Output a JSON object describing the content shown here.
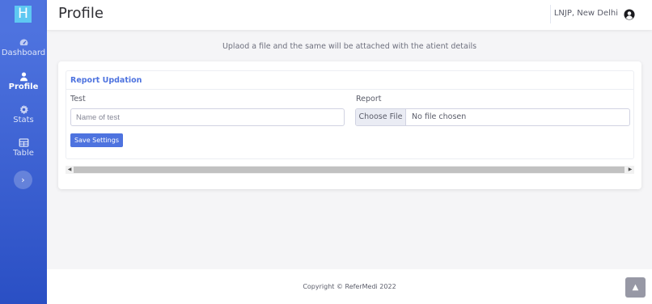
{
  "brand": {
    "letter": "H"
  },
  "sidebar": {
    "items": [
      {
        "label": "Dashboard",
        "icon": "tachometer-icon"
      },
      {
        "label": "Profile",
        "icon": "user-icon",
        "active": true
      },
      {
        "label": "Stats",
        "icon": "gear-icon"
      },
      {
        "label": "Table",
        "icon": "table-icon"
      }
    ],
    "toggle_glyph": "›"
  },
  "topbar": {
    "title": "Profile",
    "user_name": "LNJP, New Delhi"
  },
  "main": {
    "subtitle": "Uplaod a file and the same will be attached with the atient details",
    "card": {
      "header": "Report Updation",
      "test_label": "Test",
      "test_placeholder": "Name of test",
      "report_label": "Report",
      "file_button": "Choose File",
      "file_status": "No file chosen",
      "save_button": "Save Settings"
    }
  },
  "footer": {
    "copyright": "Copyright © ReferMedi 2022"
  },
  "colors": {
    "primary": "#4e73df",
    "brand_tile": "#5ec8f2",
    "scroll_top": "#858796"
  }
}
